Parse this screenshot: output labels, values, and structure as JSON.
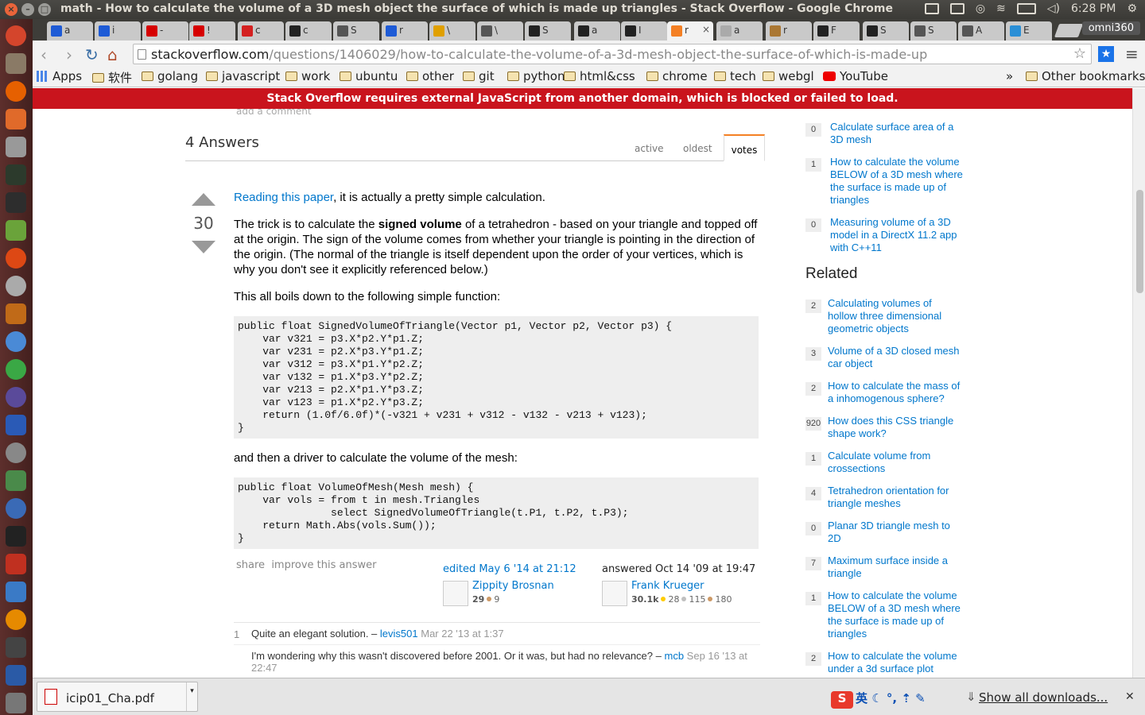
{
  "window": {
    "title": "math - How to calculate the volume of a 3D mesh object the surface of which is made up triangles - Stack Overflow - Google Chrome",
    "clock": "6:28 PM",
    "profile": "omni360"
  },
  "tabs": [
    {
      "label": "a",
      "color": "#1e5bd6"
    },
    {
      "label": "i",
      "color": "#1e5bd6"
    },
    {
      "label": "-",
      "color": "#d60000"
    },
    {
      "label": "!",
      "color": "#d60000"
    },
    {
      "label": "c",
      "color": "#d42020"
    },
    {
      "label": "c",
      "color": "#222222"
    },
    {
      "label": "S",
      "color": "#555555"
    },
    {
      "label": "r",
      "color": "#1e5bd6"
    },
    {
      "label": "\\",
      "color": "#e0a000"
    },
    {
      "label": "\\",
      "color": "#555555"
    },
    {
      "label": "S",
      "color": "#222222"
    },
    {
      "label": "a",
      "color": "#222222"
    },
    {
      "label": "I",
      "color": "#222222"
    },
    {
      "label": "r",
      "color": "#f48024",
      "active": true
    },
    {
      "label": "a",
      "color": "#aaaaaa"
    },
    {
      "label": "r",
      "color": "#aa7733"
    },
    {
      "label": "F",
      "color": "#222222"
    },
    {
      "label": "S",
      "color": "#222222"
    },
    {
      "label": "S",
      "color": "#555555"
    },
    {
      "label": "A",
      "color": "#555555"
    },
    {
      "label": "E",
      "color": "#2a8fd6"
    }
  ],
  "address": {
    "host": "stackoverflow.com",
    "path": "/questions/1406029/how-to-calculate-the-volume-of-a-3d-mesh-object-the-surface-of-which-is-made-up"
  },
  "bookmarks": [
    "Apps",
    "软件",
    "golang",
    "javascript",
    "work",
    "ubuntu",
    "other",
    "git",
    "python",
    "html&css",
    "chrome",
    "tech",
    "webgl",
    "YouTube"
  ],
  "bookmarks_more": "»",
  "bookmarks_other": "Other bookmarks",
  "banner": "Stack Overflow requires external JavaScript from another domain, which is blocked or failed to load.",
  "answers": {
    "add_comment": "add a comment",
    "count_label": "4 Answers",
    "sort_tabs": [
      "active",
      "oldest",
      "votes"
    ],
    "vote_count": "30",
    "intro_link": "Reading this paper",
    "intro_rest": ", it is actually a pretty simple calculation.",
    "p2_before": "The trick is to calculate the ",
    "p2_bold": "signed volume",
    "p2_after": " of a tetrahedron - based on your triangle and topped off at the origin. The sign of the volume comes from whether your triangle is pointing in the direction of the origin. (The normal of the triangle is itself dependent upon the order of your vertices, which is why you don't see it explicitly referenced below.)",
    "p3": "This all boils down to the following simple function:",
    "code1": "public float SignedVolumeOfTriangle(Vector p1, Vector p2, Vector p3) {\n    var v321 = p3.X*p2.Y*p1.Z;\n    var v231 = p2.X*p3.Y*p1.Z;\n    var v312 = p3.X*p1.Y*p2.Z;\n    var v132 = p1.X*p3.Y*p2.Z;\n    var v213 = p2.X*p1.Y*p3.Z;\n    var v123 = p1.X*p2.Y*p3.Z;\n    return (1.0f/6.0f)*(-v321 + v231 + v312 - v132 - v213 + v123);\n}",
    "p4": "and then a driver to calculate the volume of the mesh:",
    "code2": "public float VolumeOfMesh(Mesh mesh) {\n    var vols = from t in mesh.Triangles\n               select SignedVolumeOfTriangle(t.P1, t.P2, t.P3);\n    return Math.Abs(vols.Sum());\n}",
    "menu_share": "share",
    "menu_improve": "improve this answer",
    "edited": {
      "when": "edited May 6 '14 at 21:12",
      "user": "Zippity Brosnan",
      "rep": "29",
      "bronze": "9"
    },
    "answered": {
      "when": "answered Oct 14 '09 at 19:47",
      "user": "Frank Krueger",
      "rep": "30.1k",
      "gold": "28",
      "silver": "115",
      "bronze": "180"
    },
    "comments": [
      {
        "score": "1",
        "text": "Quite an elegant solution. –",
        "user": "levis501",
        "date": "Mar 22 '13 at 1:37"
      },
      {
        "score": "",
        "text": "I'm wondering why this wasn't discovered before 2001. Or it was, but had no relevance? –",
        "user": "mcb",
        "date": "Sep 16 '13 at 22:47"
      }
    ]
  },
  "linked": [
    {
      "score": "0",
      "title": "Calculate surface area of a 3D mesh"
    },
    {
      "score": "1",
      "title": "How to calculate the volume BELOW of a 3D mesh where the surface is made up of triangles"
    },
    {
      "score": "0",
      "title": "Measuring volume of a 3D model in a DirectX 11.2 app with C++11"
    }
  ],
  "related_title": "Related",
  "related": [
    {
      "score": "2",
      "title": "Calculating volumes of hollow three dimensional geometric objects"
    },
    {
      "score": "3",
      "title": "Volume of a 3D closed mesh car object"
    },
    {
      "score": "2",
      "title": "How to calculate the mass of a inhomogenous sphere?"
    },
    {
      "score": "920",
      "title": "How does this CSS triangle shape work?"
    },
    {
      "score": "1",
      "title": "Calculate volume from crossections"
    },
    {
      "score": "4",
      "title": "Tetrahedron orientation for triangle meshes"
    },
    {
      "score": "0",
      "title": "Planar 3D triangle mesh to 2D"
    },
    {
      "score": "7",
      "title": "Maximum surface inside a triangle"
    },
    {
      "score": "1",
      "title": "How to calculate the volume BELOW of a 3D mesh where the surface is made up of triangles"
    },
    {
      "score": "2",
      "title": "How to calculate the volume under a 3d surface plot"
    }
  ],
  "downloads": {
    "file": "icip01_Cha.pdf",
    "show_all": "Show all downloads...",
    "ime": "英"
  },
  "colors": {
    "banner": "#c9141d",
    "link": "#0077cc",
    "accent": "#f48024",
    "launcher": "#5d2f2c"
  }
}
